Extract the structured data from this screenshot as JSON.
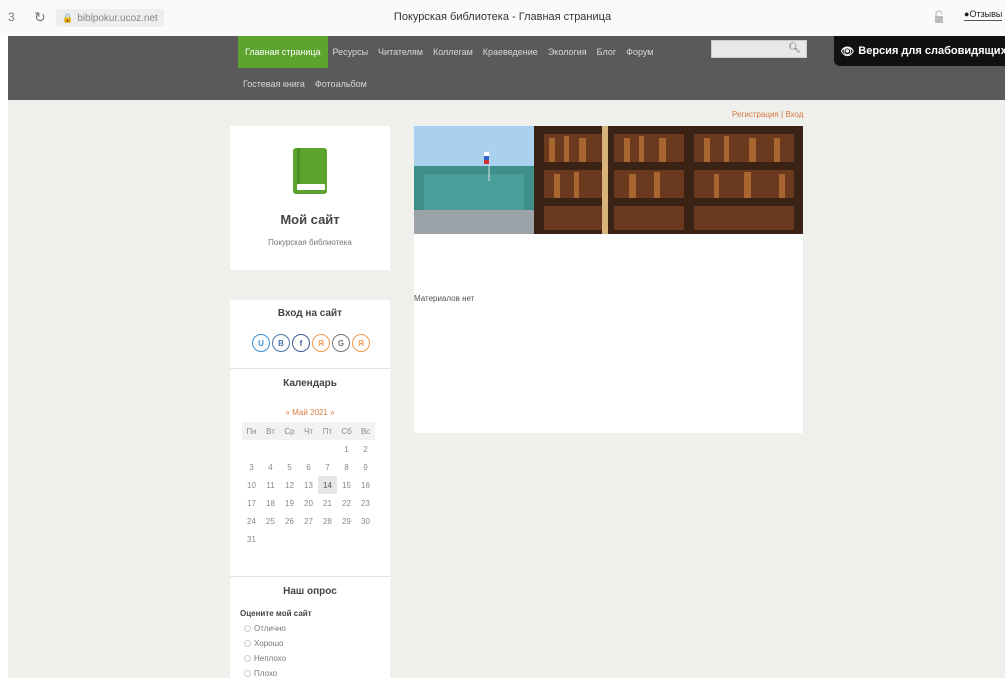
{
  "browser": {
    "tab_number": "3",
    "url": "biblpokur.ucoz.net",
    "title": "Покурская библиотека - Главная страница",
    "feedback": "Отзывы"
  },
  "nav": {
    "row1": [
      {
        "label": "Главная страница",
        "active": true
      },
      {
        "label": "Ресурсы"
      },
      {
        "label": "Читателям"
      },
      {
        "label": "Коллегам"
      },
      {
        "label": "Краеведение"
      },
      {
        "label": "Экология"
      },
      {
        "label": "Блог"
      },
      {
        "label": "Форум"
      }
    ],
    "row2": [
      {
        "label": "Гостевая книга"
      },
      {
        "label": "Фотоальбом"
      }
    ]
  },
  "search": {
    "placeholder": ""
  },
  "accessibility_button": "Версия для слабовидящих",
  "auth": {
    "register": "Регистрация",
    "separator": "|",
    "login": "Вход"
  },
  "site": {
    "title": "Мой сайт",
    "subtitle": "Покурская библиотека"
  },
  "login_block": {
    "title": "Вход на сайт",
    "providers": [
      {
        "letter": "U",
        "color": "#3a8fd6"
      },
      {
        "letter": "B",
        "color": "#4a76a8"
      },
      {
        "letter": "f",
        "color": "#3b5998"
      },
      {
        "letter": "Я",
        "color": "#f39a4b"
      },
      {
        "letter": "G",
        "color": "#777777"
      },
      {
        "letter": "Я",
        "color": "#f39a4b"
      }
    ]
  },
  "calendar": {
    "title": "Календарь",
    "prev": "«",
    "month": "Май 2021",
    "next": "»",
    "weekdays": [
      "Пн",
      "Вт",
      "Ср",
      "Чт",
      "Пт",
      "Сб",
      "Вс"
    ],
    "weeks": [
      [
        "",
        "",
        "",
        "",
        "",
        "1",
        "2"
      ],
      [
        "3",
        "4",
        "5",
        "6",
        "7",
        "8",
        "9"
      ],
      [
        "10",
        "11",
        "12",
        "13",
        "14",
        "15",
        "16"
      ],
      [
        "17",
        "18",
        "19",
        "20",
        "21",
        "22",
        "23"
      ],
      [
        "24",
        "25",
        "26",
        "27",
        "28",
        "29",
        "30"
      ],
      [
        "31",
        "",
        "",
        "",
        "",
        "",
        ""
      ]
    ],
    "today": "14"
  },
  "poll": {
    "title": "Наш опрос",
    "question": "Оцените мой сайт",
    "options": [
      "Отлично",
      "Хорошо",
      "Неплохо",
      "Плохо"
    ]
  },
  "main": {
    "empty_text": "Материалов нет"
  },
  "colors": {
    "accent": "#5da42f",
    "header": "#5a5a5a",
    "link": "#d9783e"
  }
}
